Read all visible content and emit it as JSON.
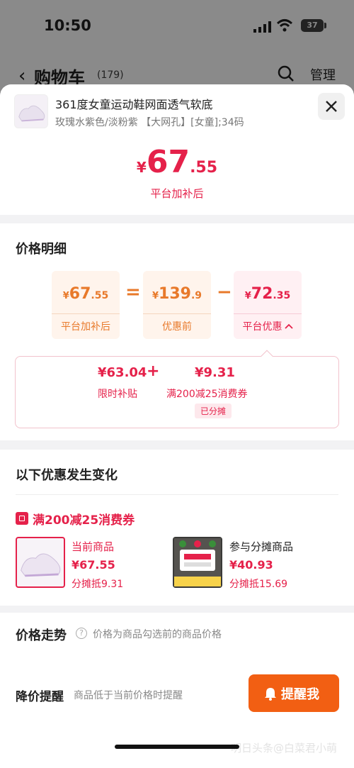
{
  "status_bar": {
    "time": "10:50",
    "battery": "37"
  },
  "nav": {
    "title": "购物车",
    "count": "(179)",
    "manage": "管理"
  },
  "product": {
    "title": "361度女童运动鞋网面透气软底",
    "spec": "玫瑰水紫色/淡粉紫 【大网孔】[女童];34码",
    "price": {
      "currency": "¥",
      "integer": "67",
      "decimal": ".55"
    },
    "price_label": "平台加补后"
  },
  "price_detail": {
    "title": "价格明细",
    "final": {
      "currency": "¥",
      "integer": "67",
      "decimal": ".55",
      "label": "平台加补后"
    },
    "equals": "=",
    "original": {
      "currency": "¥",
      "integer": "139",
      "decimal": ".9",
      "label": "优惠前"
    },
    "minus": "−",
    "discount": {
      "currency": "¥",
      "integer": "72",
      "decimal": ".35",
      "label": "平台优惠"
    },
    "breakdown": {
      "subsidy_value": "¥63.04",
      "plus": "+",
      "coupon_value": "¥9.31",
      "subsidy_label": "限时补贴",
      "coupon_label": "满200减25消费券",
      "shared_tag": "已分摊"
    }
  },
  "changes": {
    "title": "以下优惠发生变化",
    "coupon_title": "满200减25消费券",
    "current": {
      "label": "当前商品",
      "price": "¥67.55",
      "share": "分摊抵9.31"
    },
    "shared": {
      "label": "参与分摊商品",
      "price": "¥40.93",
      "share": "分摊抵15.69"
    }
  },
  "trend": {
    "title": "价格走势",
    "note": "价格为商品勾选前的商品价格",
    "alert_title": "降价提醒",
    "alert_note": "商品低于当前价格时提醒",
    "remind_button": "提醒我",
    "watermark": "明日头条@白菜君小萌"
  },
  "colors": {
    "accent_red": "#e5214a",
    "accent_orange": "#e8792a",
    "button_orange": "#f25f13"
  }
}
